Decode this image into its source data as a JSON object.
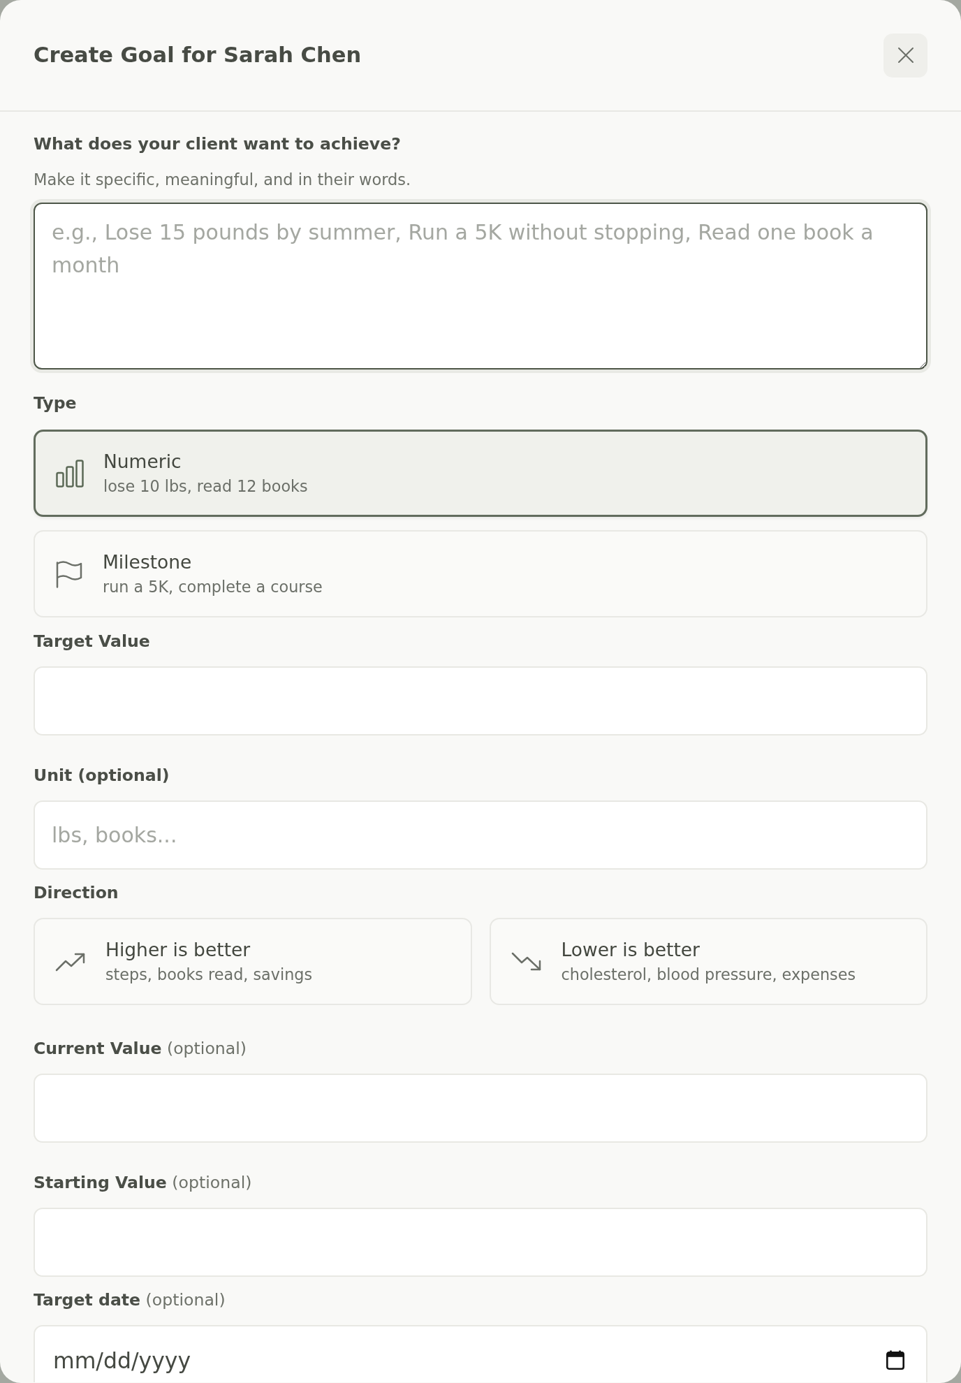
{
  "dialog": {
    "title": "Create Goal for Sarah Chen"
  },
  "fields": [
    {
      "kind": "goal_text",
      "label": "What does your client want to achieve?",
      "hint": "Make it specific, meaningful, and in their words.",
      "placeholder": "e.g., Lose 15 pounds by summer, Run a 5K without stopping, Read one book a month",
      "focused": true
    },
    {
      "kind": "type_choice",
      "label": "Type",
      "options": [
        {
          "kind": "numeric",
          "title": "Numeric",
          "description": "lose 10 lbs, read 12 books",
          "selected": true
        },
        {
          "kind": "milestone",
          "title": "Milestone",
          "description": "run a 5K, complete a course",
          "selected": false
        }
      ]
    },
    {
      "kind": "number",
      "label": "Target Value",
      "focused": false
    },
    {
      "kind": "text",
      "label": "Unit (optional)",
      "placeholder": "lbs, books...",
      "focused": false
    },
    {
      "kind": "direction_choice",
      "label": "Direction",
      "options": [
        {
          "kind": "higher",
          "title": "Higher is better",
          "description": "steps, books read, savings",
          "selected": false
        },
        {
          "kind": "lower",
          "title": "Lower is better",
          "description": "cholesterol, blood pressure, expenses",
          "selected": false
        }
      ]
    },
    {
      "kind": "number",
      "label": "**Current Value** (optional)",
      "focused": false
    },
    {
      "kind": "number",
      "label": "**Starting Value** (optional)",
      "focused": false
    },
    {
      "kind": "date",
      "label": "**Target date** (optional)",
      "placeholder": "mm/dd/yyyy",
      "focused": false
    }
  ]
}
